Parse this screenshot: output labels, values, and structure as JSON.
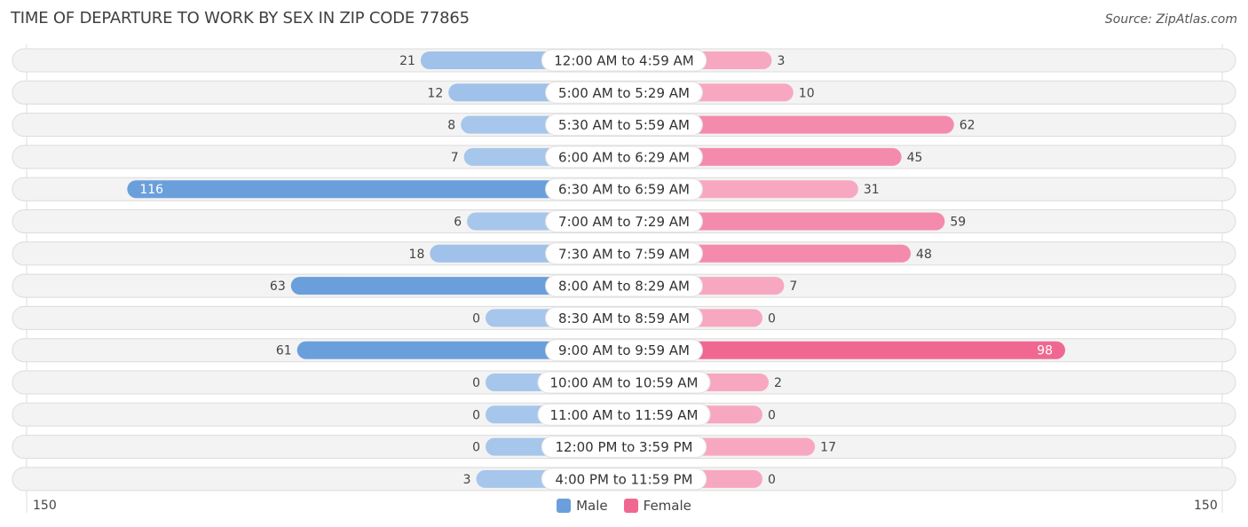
{
  "chart_data": {
    "type": "bar",
    "orientation": "horizontal-diverging",
    "title": "TIME OF DEPARTURE TO WORK BY SEX IN ZIP CODE 77865",
    "source": "Source: ZipAtlas.com",
    "categories": [
      "12:00 AM to 4:59 AM",
      "5:00 AM to 5:29 AM",
      "5:30 AM to 5:59 AM",
      "6:00 AM to 6:29 AM",
      "6:30 AM to 6:59 AM",
      "7:00 AM to 7:29 AM",
      "7:30 AM to 7:59 AM",
      "8:00 AM to 8:29 AM",
      "8:30 AM to 8:59 AM",
      "9:00 AM to 9:59 AM",
      "10:00 AM to 10:59 AM",
      "11:00 AM to 11:59 AM",
      "12:00 PM to 3:59 PM",
      "4:00 PM to 11:59 PM"
    ],
    "series": [
      {
        "name": "Male",
        "color": "#6a9fdb",
        "color_light": "#a7c6eb",
        "values": [
          21,
          12,
          8,
          7,
          116,
          6,
          18,
          63,
          0,
          61,
          0,
          0,
          0,
          3
        ]
      },
      {
        "name": "Female",
        "color": "#f06892",
        "color_light": "#f7a8c0",
        "values": [
          3,
          10,
          62,
          45,
          31,
          59,
          48,
          7,
          0,
          98,
          2,
          0,
          17,
          0
        ]
      }
    ],
    "axis": {
      "min_label": "150",
      "max_label": "150",
      "range": [
        0,
        150
      ]
    },
    "legend": {
      "position": "bottom-center",
      "entries": [
        "Male",
        "Female"
      ]
    }
  }
}
